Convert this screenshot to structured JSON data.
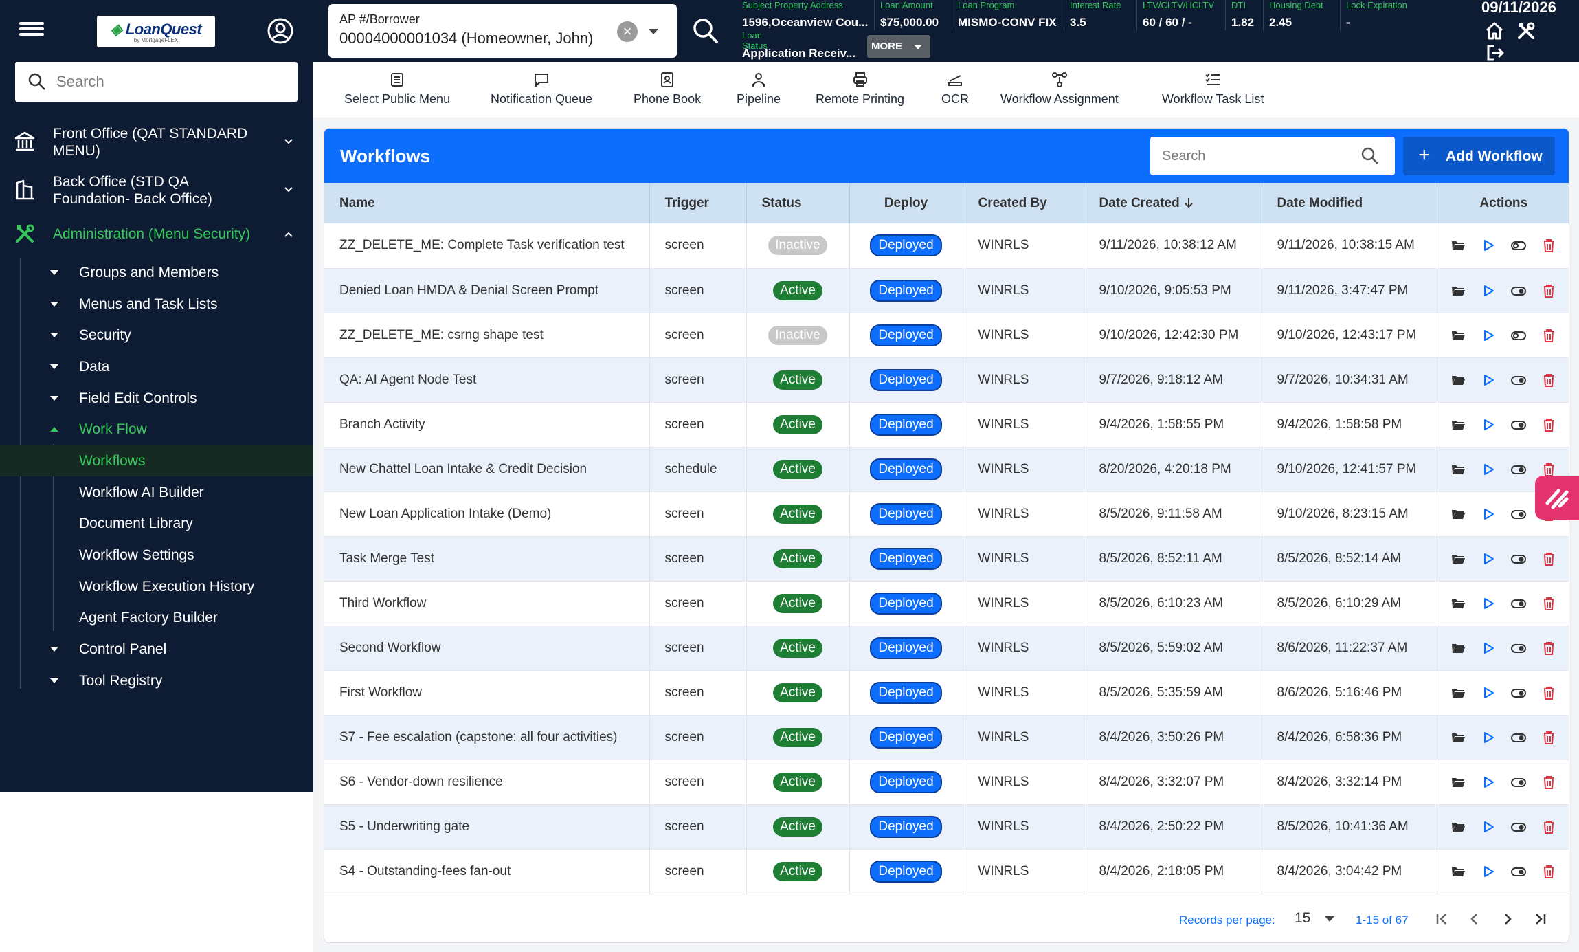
{
  "topbar": {
    "logo_text": "LoanQuest",
    "logo_sub": "by MortgageFLEX",
    "borrower_label": "AP #/Borrower",
    "borrower_value": "00004000001034 (Homeowner, John)",
    "loan_info": [
      {
        "label": "Subject Property Address",
        "value": "1596,Oceanview Cou..."
      },
      {
        "label": "Loan Amount",
        "value": "$75,000.00"
      },
      {
        "label": "Loan Program",
        "value": "MISMO-CONV FIX"
      },
      {
        "label": "Interest Rate",
        "value": "3.5"
      },
      {
        "label": "LTV/CLTV/HCLTV",
        "value": "60 / 60 / -"
      },
      {
        "label": "DTI",
        "value": "1.82"
      },
      {
        "label": "Housing Debt",
        "value": "2.45"
      },
      {
        "label": "Lock Expiration",
        "value": "-"
      }
    ],
    "loan_status_label": "Loan Status",
    "loan_status_value": "Application Receiv...",
    "more_label": "MORE",
    "date": "09/11/2026"
  },
  "sidebar": {
    "search_placeholder": "Search",
    "groups": [
      {
        "label": "Front Office (QAT STANDARD MENU)"
      },
      {
        "label": "Back Office (STD QA Foundation- Back Office)"
      },
      {
        "label": "Administration (Menu Security)"
      }
    ],
    "items": [
      {
        "label": "Groups and Members"
      },
      {
        "label": "Menus and Task Lists"
      },
      {
        "label": "Security"
      },
      {
        "label": "Data"
      },
      {
        "label": "Field Edit Controls"
      },
      {
        "label": "Work Flow"
      }
    ],
    "subitems": [
      {
        "label": "Workflows"
      },
      {
        "label": "Workflow AI Builder"
      },
      {
        "label": "Document Library"
      },
      {
        "label": "Workflow Settings"
      },
      {
        "label": "Workflow Execution History"
      },
      {
        "label": "Agent Factory Builder"
      }
    ],
    "items_after": [
      {
        "label": "Control Panel"
      },
      {
        "label": "Tool Registry"
      }
    ]
  },
  "quickmenu": [
    {
      "label": "Select Public Menu",
      "icon": "menu-list-icon"
    },
    {
      "label": "Notification Queue",
      "icon": "chat-bubble-icon"
    },
    {
      "label": "Phone Book",
      "icon": "contact-book-icon"
    },
    {
      "label": "Pipeline",
      "icon": "person-icon"
    },
    {
      "label": "Remote Printing",
      "icon": "printer-icon"
    },
    {
      "label": "OCR",
      "icon": "scanner-icon"
    },
    {
      "label": "Workflow Assignment",
      "icon": "workflow-nodes-icon"
    },
    {
      "label": "Workflow Task List",
      "icon": "checklist-icon"
    }
  ],
  "workflows": {
    "title": "Workflows",
    "search_placeholder": "Search",
    "add_label": "Add Workflow",
    "columns": [
      "Name",
      "Trigger",
      "Status",
      "Deploy",
      "Created By",
      "Date Created",
      "Date Modified",
      "Actions"
    ],
    "rows": [
      {
        "name": "ZZ_DELETE_ME: Complete Task verification test",
        "trigger": "screen",
        "status": "Inactive",
        "deploy": "Deployed",
        "created_by": "WINRLS",
        "date_created": "9/11/2026, 10:38:12 AM",
        "date_modified": "9/11/2026, 10:38:15 AM"
      },
      {
        "name": "Denied Loan HMDA & Denial Screen Prompt",
        "trigger": "screen",
        "status": "Active",
        "deploy": "Deployed",
        "created_by": "WINRLS",
        "date_created": "9/10/2026, 9:05:53 PM",
        "date_modified": "9/11/2026, 3:47:47 PM"
      },
      {
        "name": "ZZ_DELETE_ME: csrng shape test",
        "trigger": "screen",
        "status": "Inactive",
        "deploy": "Deployed",
        "created_by": "WINRLS",
        "date_created": "9/10/2026, 12:42:30 PM",
        "date_modified": "9/10/2026, 12:43:17 PM"
      },
      {
        "name": "QA: AI Agent Node Test",
        "trigger": "screen",
        "status": "Active",
        "deploy": "Deployed",
        "created_by": "WINRLS",
        "date_created": "9/7/2026, 9:18:12 AM",
        "date_modified": "9/7/2026, 10:34:31 AM"
      },
      {
        "name": "Branch Activity",
        "trigger": "screen",
        "status": "Active",
        "deploy": "Deployed",
        "created_by": "WINRLS",
        "date_created": "9/4/2026, 1:58:55 PM",
        "date_modified": "9/4/2026, 1:58:58 PM"
      },
      {
        "name": "New Chattel Loan Intake & Credit Decision",
        "trigger": "schedule",
        "status": "Active",
        "deploy": "Deployed",
        "created_by": "WINRLS",
        "date_created": "8/20/2026, 4:20:18 PM",
        "date_modified": "9/10/2026, 12:41:57 PM"
      },
      {
        "name": "New Loan Application Intake (Demo)",
        "trigger": "screen",
        "status": "Active",
        "deploy": "Deployed",
        "created_by": "WINRLS",
        "date_created": "8/5/2026, 9:11:58 AM",
        "date_modified": "9/10/2026, 8:23:15 AM"
      },
      {
        "name": "Task Merge Test",
        "trigger": "screen",
        "status": "Active",
        "deploy": "Deployed",
        "created_by": "WINRLS",
        "date_created": "8/5/2026, 8:52:11 AM",
        "date_modified": "8/5/2026, 8:52:14 AM"
      },
      {
        "name": "Third Workflow",
        "trigger": "screen",
        "status": "Active",
        "deploy": "Deployed",
        "created_by": "WINRLS",
        "date_created": "8/5/2026, 6:10:23 AM",
        "date_modified": "8/5/2026, 6:10:29 AM"
      },
      {
        "name": "Second Workflow",
        "trigger": "screen",
        "status": "Active",
        "deploy": "Deployed",
        "created_by": "WINRLS",
        "date_created": "8/5/2026, 5:59:02 AM",
        "date_modified": "8/6/2026, 11:22:37 AM"
      },
      {
        "name": "First Workflow",
        "trigger": "screen",
        "status": "Active",
        "deploy": "Deployed",
        "created_by": "WINRLS",
        "date_created": "8/5/2026, 5:35:59 AM",
        "date_modified": "8/6/2026, 5:16:46 PM"
      },
      {
        "name": "S7 - Fee escalation (capstone: all four activities)",
        "trigger": "screen",
        "status": "Active",
        "deploy": "Deployed",
        "created_by": "WINRLS",
        "date_created": "8/4/2026, 3:50:26 PM",
        "date_modified": "8/4/2026, 6:58:36 PM"
      },
      {
        "name": "S6 - Vendor-down resilience",
        "trigger": "screen",
        "status": "Active",
        "deploy": "Deployed",
        "created_by": "WINRLS",
        "date_created": "8/4/2026, 3:32:07 PM",
        "date_modified": "8/4/2026, 3:32:14 PM"
      },
      {
        "name": "S5 - Underwriting gate",
        "trigger": "screen",
        "status": "Active",
        "deploy": "Deployed",
        "created_by": "WINRLS",
        "date_created": "8/4/2026, 2:50:22 PM",
        "date_modified": "8/5/2026, 10:41:36 AM"
      },
      {
        "name": "S4 - Outstanding-fees fan-out",
        "trigger": "screen",
        "status": "Active",
        "deploy": "Deployed",
        "created_by": "WINRLS",
        "date_created": "8/4/2026, 2:18:05 PM",
        "date_modified": "8/4/2026, 3:04:42 PM"
      }
    ],
    "paging": {
      "records_label": "Records per page:",
      "per_page": "15",
      "range": "1-15 of 67"
    }
  },
  "colors": {
    "nav_bg": "#0d1b33",
    "accent_green": "#34c759",
    "primary_blue": "#0d6efd",
    "active_green": "#1e7e34",
    "delete_red": "#dc3545"
  }
}
